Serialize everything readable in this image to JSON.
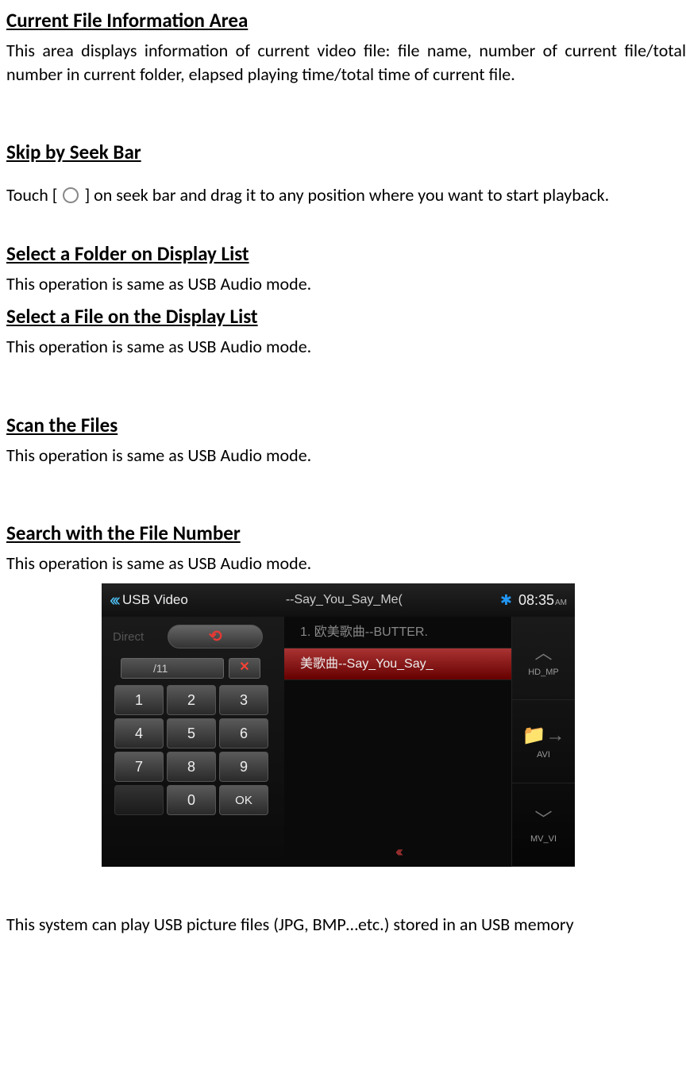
{
  "sections": {
    "s1": {
      "heading": "Current File Information Area",
      "heading_trail": " ",
      "body": "This area displays information of current video file: file name, number of current file/total number in current folder, elapsed playing time/total time of current file."
    },
    "s2": {
      "heading": "Skip by Seek Bar",
      "body_pre": "Touch [ ",
      "body_post": " ] on seek bar and drag it to any position where you want to start playback."
    },
    "s3": {
      "heading": "Select a Folder on Display List",
      "body": "This operation is same as USB Audio mode."
    },
    "s4": {
      "heading": "Select a File on the Display List",
      "body": "This operation is same as USB Audio mode."
    },
    "s5": {
      "heading": "Scan the Files",
      "heading_trail": " ",
      "body": "This operation is same as USB Audio mode."
    },
    "s6": {
      "heading": "Search with the File Number",
      "body": "This operation is same as USB Audio mode."
    }
  },
  "device": {
    "back_chevrons": "‹‹‹",
    "title": "USB Video",
    "now_playing": "--Say_You_Say_Me(",
    "bt_glyph": "✱",
    "clock": "08:35",
    "clock_suffix": "AM",
    "direct_label": "Direct",
    "back_glyph": "⟲",
    "input_value": "/11",
    "clear_glyph": "✕",
    "keys": [
      "1",
      "2",
      "3",
      "4",
      "5",
      "6",
      "7",
      "8",
      "9",
      "",
      "0",
      "OK"
    ],
    "list": {
      "row1": "1. 欧美歌曲--BUTTER.",
      "row2": "美歌曲--Say_You_Say_"
    },
    "bottom_chev": "‹‹‹",
    "right": {
      "item1_label": "HD_MP",
      "item1_glyph": "︿",
      "item2_label": "AVI",
      "item2_glyph": "📁→",
      "item3_label": "MV_VI",
      "item3_glyph": "﹀"
    }
  },
  "footer": {
    "text": "This system can play USB picture files (JPG, BMP…etc.) stored in an USB memory"
  }
}
